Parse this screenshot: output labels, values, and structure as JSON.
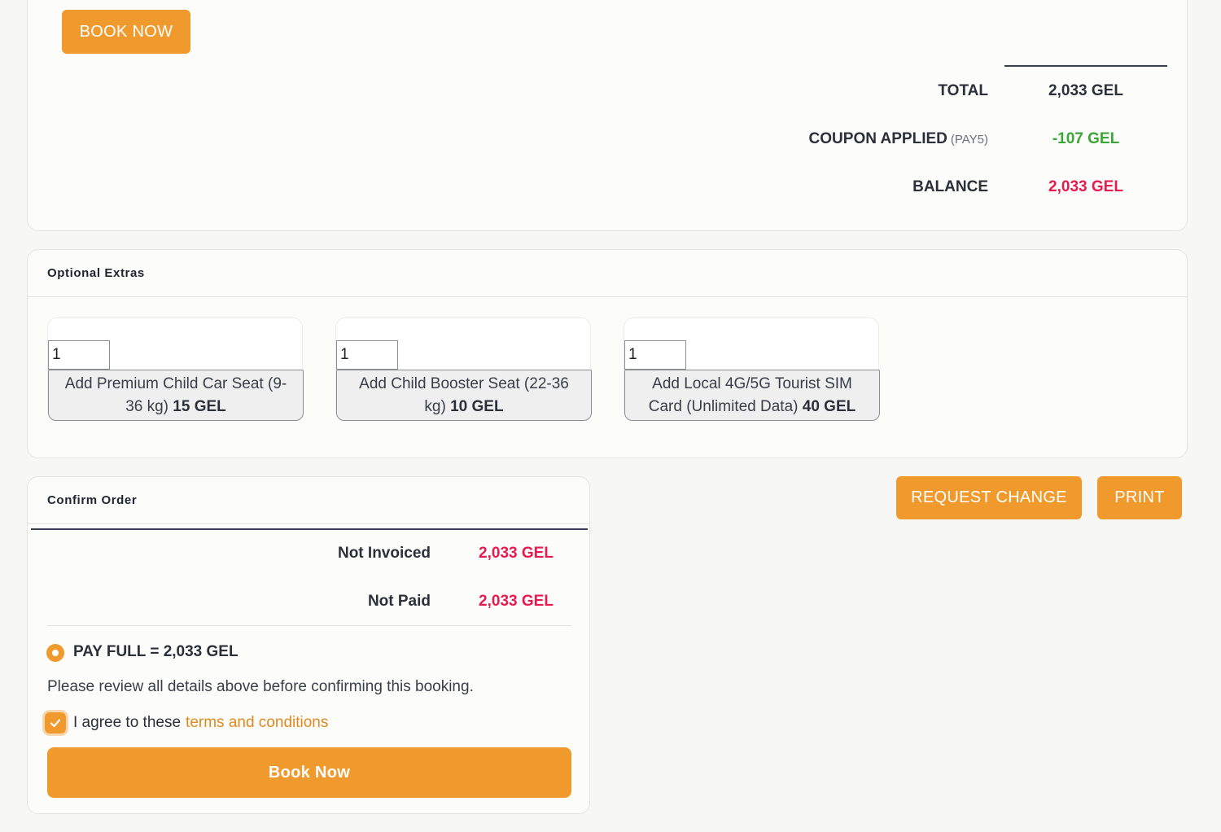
{
  "summary": {
    "book_now_label": "BOOK NOW",
    "total_label": "TOTAL",
    "total_value": "2,033 GEL",
    "coupon_label": "COUPON APPLIED",
    "coupon_code": "(PAY5)",
    "coupon_value": "-107 GEL",
    "balance_label": "BALANCE",
    "balance_value": "2,033 GEL",
    "colors": {
      "coupon": "#3aa635",
      "balance": "#e8194f",
      "accent": "#f09a2e"
    }
  },
  "extras": {
    "title": "Optional Extras",
    "items": [
      {
        "qty": "1",
        "label": "Add Premium Child Car Seat (9-36 kg)",
        "price": "15 GEL"
      },
      {
        "qty": "1",
        "label": "Add Child Booster Seat (22-36 kg)",
        "price": "10 GEL"
      },
      {
        "qty": "1",
        "label": "Add Local 4G/5G Tourist SIM Card (Unlimited Data)",
        "price": "40 GEL"
      }
    ]
  },
  "confirm": {
    "title": "Confirm Order",
    "not_invoiced_label": "Not Invoiced",
    "not_invoiced_value": "2,033 GEL",
    "not_paid_label": "Not Paid",
    "not_paid_value": "2,033 GEL",
    "pay_option_label": "PAY FULL = 2,033 GEL",
    "review_text": "Please review all details above before confirming this booking.",
    "agree_text": "I agree to these",
    "terms_link": "terms and conditions",
    "book_now_label": "Book Now"
  },
  "actions": {
    "request_change_label": "REQUEST CHANGE",
    "print_label": "PRINT"
  }
}
